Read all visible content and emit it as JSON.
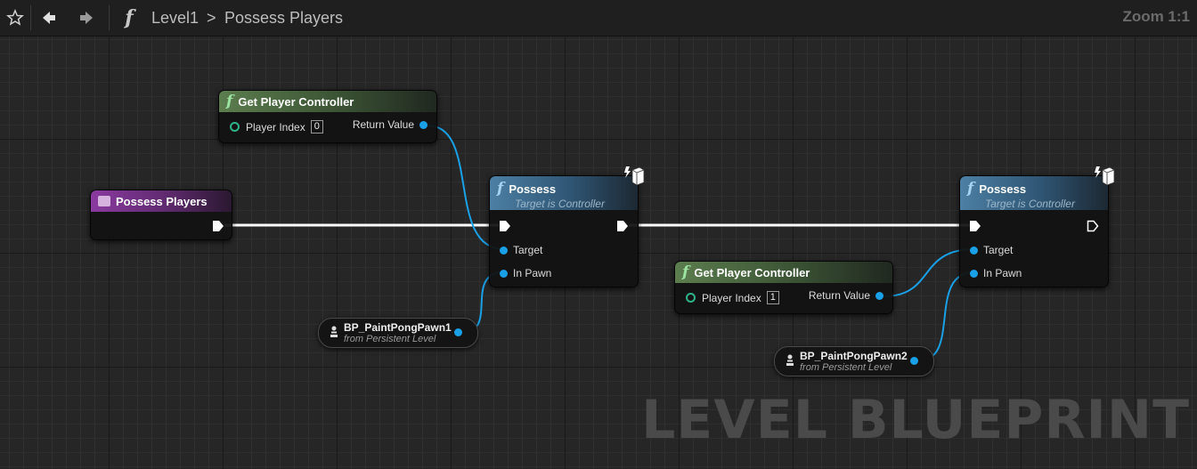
{
  "breadcrumb": {
    "level": "Level1",
    "separator": ">",
    "graph": "Possess Players"
  },
  "zoom": "Zoom 1:1",
  "watermark": "LEVEL BLUEPRINT",
  "colors": {
    "function_header": "#3b5334",
    "possess_header": "#2f5573",
    "event_header": "#5e2a6e",
    "object_pin": "#1aa0e6",
    "int_pin": "#2fb38a",
    "exec_wire": "#ffffff"
  },
  "icons": {
    "favorite": "star-icon",
    "back": "arrow-left-icon",
    "forward": "arrow-right-icon",
    "function": "function-f-icon"
  },
  "nodes": {
    "gpc1": {
      "title": "Get Player Controller",
      "input_label": "Player Index",
      "input_value": "0",
      "output_label": "Return Value"
    },
    "event": {
      "title": "Possess Players"
    },
    "possess1": {
      "title": "Possess",
      "subtitle": "Target is Controller",
      "pin_target": "Target",
      "pin_pawn": "In Pawn"
    },
    "possess2": {
      "title": "Possess",
      "subtitle": "Target is Controller",
      "pin_target": "Target",
      "pin_pawn": "In Pawn"
    },
    "gpc2": {
      "title": "Get Player Controller",
      "input_label": "Player Index",
      "input_value": "1",
      "output_label": "Return Value"
    },
    "pawn1": {
      "title": "BP_PaintPongPawn1",
      "subtitle": "from Persistent Level"
    },
    "pawn2": {
      "title": "BP_PaintPongPawn2",
      "subtitle": "from Persistent Level"
    }
  }
}
